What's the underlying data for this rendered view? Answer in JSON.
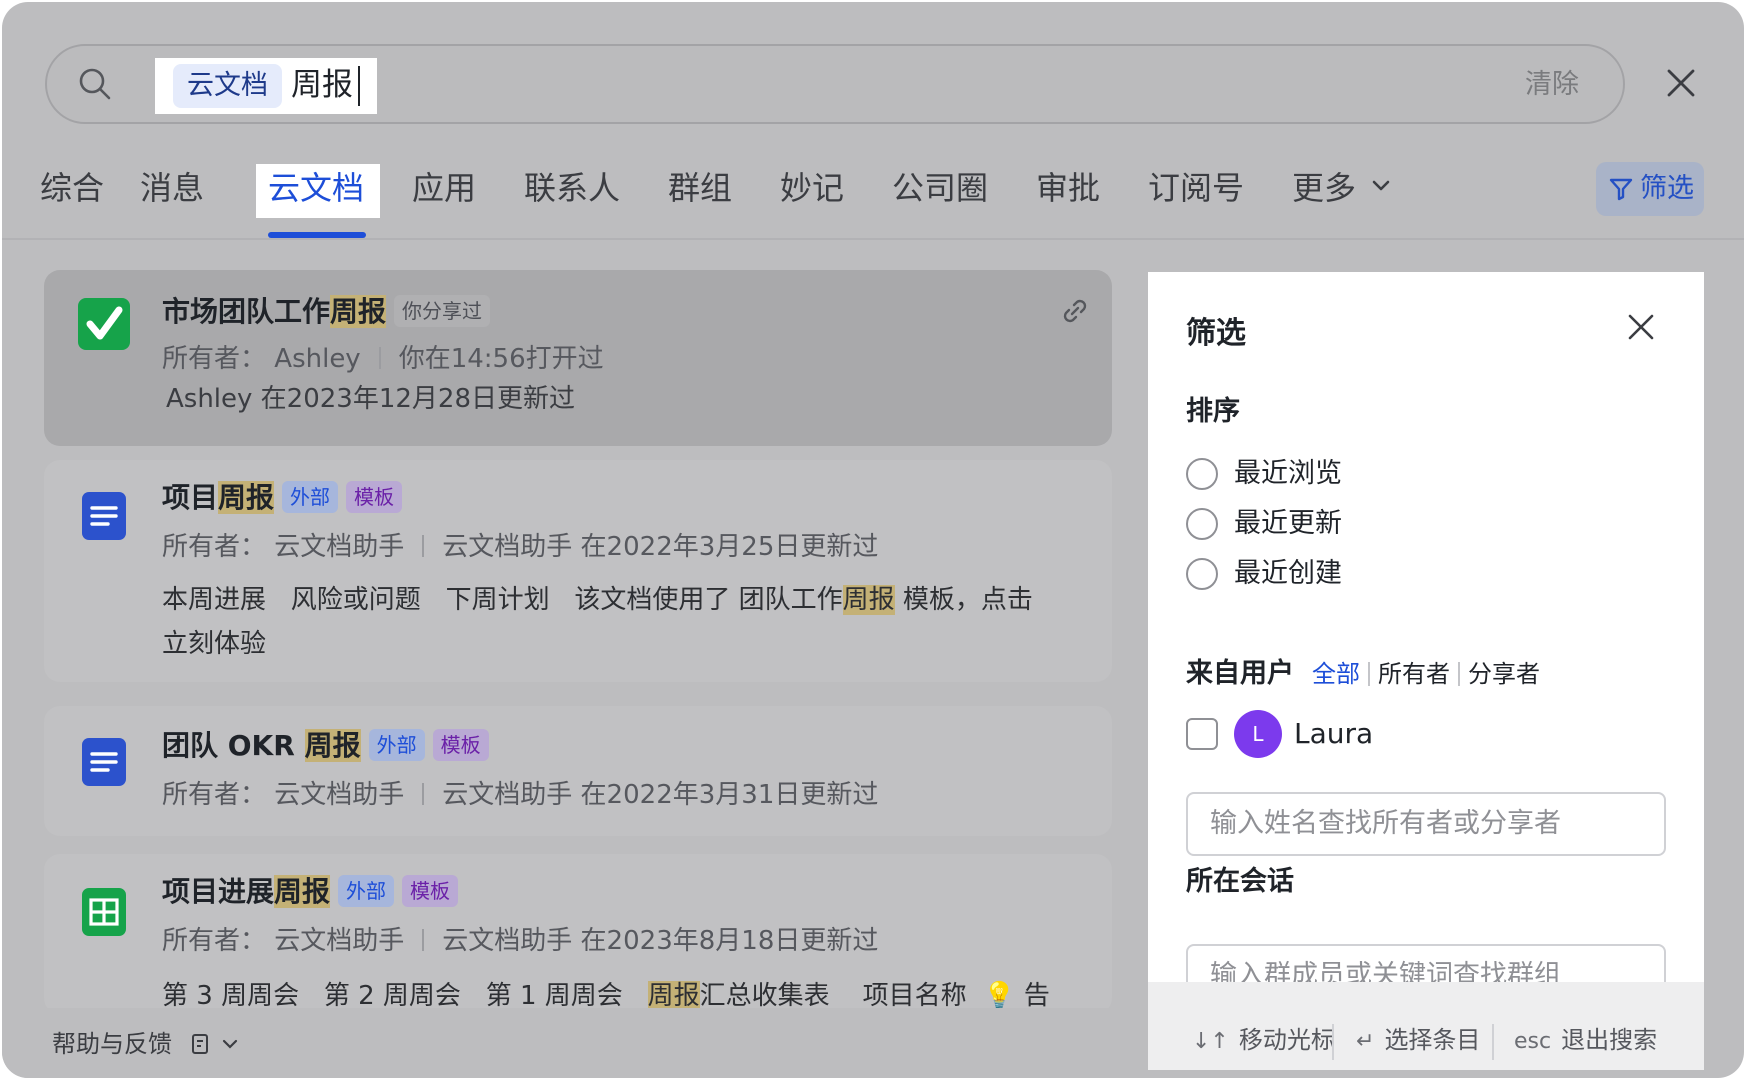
{
  "search": {
    "scope_chip": "云文档",
    "query": "周报",
    "clear_label": "清除"
  },
  "tabs": [
    {
      "label": "综合"
    },
    {
      "label": "消息"
    },
    {
      "label": "云文档"
    },
    {
      "label": "应用"
    },
    {
      "label": "联系人"
    },
    {
      "label": "群组"
    },
    {
      "label": "妙记"
    },
    {
      "label": "公司圈"
    },
    {
      "label": "审批"
    },
    {
      "label": "订阅号"
    },
    {
      "label": "更多"
    }
  ],
  "filter_button_label": "筛选",
  "results": [
    {
      "title_prefix": "市场团队工作",
      "title_hl": "周报",
      "title_suffix": "",
      "tags": [
        "你分享过"
      ],
      "owner_label": "所有者：",
      "owner": "Ashley",
      "activity": "你在14:56打开过",
      "line2": "Ashley 在2023年12月28日更新过"
    },
    {
      "title_prefix": "项目",
      "title_hl": "周报",
      "title_suffix": "",
      "tags": [
        "外部",
        "模板"
      ],
      "owner_label": "所有者：",
      "owner": "云文档助手",
      "activity": "云文档助手 在2022年3月25日更新过",
      "snippet_a": "本周进展   风险或问题   下周计划   该文档使用了 团队工作",
      "snippet_hl": "周报",
      "snippet_b": " 模板，点击",
      "snippet_c": "立刻体验"
    },
    {
      "title_prefix": "团队 OKR ",
      "title_hl": "周报",
      "title_suffix": "",
      "tags": [
        "外部",
        "模板"
      ],
      "owner_label": "所有者：",
      "owner": "云文档助手",
      "activity": "云文档助手 在2022年3月31日更新过"
    },
    {
      "title_prefix": "项目进展",
      "title_hl": "周报",
      "title_suffix": "",
      "tags": [
        "外部",
        "模板"
      ],
      "owner_label": "所有者：",
      "owner": "云文档助手",
      "activity": "云文档助手 在2023年8月18日更新过",
      "snippet_a": "第 3 周周会   第 2 周周会   第 1 周周会   ",
      "snippet_hl": "周报",
      "snippet_b": "汇总收集表    项目名称  💡 告"
    }
  ],
  "footer": {
    "help_label": "帮助与反馈"
  },
  "filter_panel": {
    "title": "筛选",
    "sort_title": "排序",
    "sort_options": [
      "最近浏览",
      "最近更新",
      "最近创建"
    ],
    "from_user_title": "来自用户",
    "user_filters": [
      "全部",
      "所有者",
      "分享者"
    ],
    "user": {
      "initial": "L",
      "name": "Laura"
    },
    "user_search_placeholder": "输入姓名查找所有者或分享者",
    "chat_title": "所在会话",
    "chat_search_placeholder": "输入群成员或关键词查找群组",
    "shortcuts": [
      {
        "key": "↓↑",
        "label": "移动光标"
      },
      {
        "key": "↵",
        "label": "选择条目"
      },
      {
        "key": "esc",
        "label": "退出搜索"
      }
    ]
  }
}
